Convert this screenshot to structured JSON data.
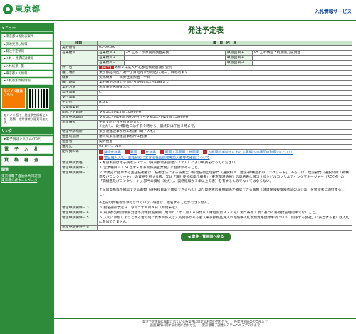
{
  "header": {
    "logo_text": "東京都",
    "service_label": "入札情報サービス"
  },
  "sidebar": {
    "menu_heading": "メニュー",
    "menu_items": [
      "▶東京都公報発表案件",
      "▶調達見通し情報",
      "▶発注予定情報",
      "▶入札・見積経過情報",
      "▶入札結果一覧",
      "▶東京都入札情報",
      "▶入札参加資格情報"
    ],
    "mobile_button": "モバイル版はこちら",
    "mobile_note": "モバイル版は、発注予定情報と入札（見積）結果情報が閲覧可能です。",
    "links_heading": "リンク",
    "system_item": "▶電子調達システム(TOP)",
    "big_items": [
      "電　子　入　札",
      "資　格　審　査"
    ],
    "related_heading": "関連",
    "related_links": [
      "東京都電子自治体共同運営",
      "東京都公式ホームページ"
    ]
  },
  "page_title": "発注予定表",
  "table_header": {
    "item": "項目",
    "content": "項　目　内　容"
  },
  "contract_no": {
    "label": "契約番号",
    "value": "05-00186"
  },
  "business_types": {
    "label": "営業種目",
    "types": [
      {
        "k": "営業種目１",
        "v": "24 土木・水系関係調査業務"
      },
      {
        "k": "営業種目２",
        "v": ""
      },
      {
        "k": "営業種目３",
        "v": ""
      }
    ],
    "handles": [
      {
        "k": "取扱品目１",
        "v": "04 土木構造・耐震耐力度調査"
      },
      {
        "k": "取扱品目２",
        "v": ""
      },
      {
        "k": "取扱品目３",
        "v": ""
      }
    ]
  },
  "rows": [
    {
      "k": "件　名",
      "v": "令和５年度大井北部陸橋耐震設計委託",
      "badge": "【電子】"
    },
    {
      "k": "履行場所",
      "v": "東京都品川区八潮一丁目地内から同区八潮二丁目地内まで"
    },
    {
      "k": "概要",
      "v": "委託概要　　橋梁性能照査　一式"
    },
    {
      "k": "履行期間",
      "v": "契約確定の日の翌日から令和6年2月29日まで"
    },
    {
      "k": "契約方法",
      "v": "希望制指名競争入札"
    },
    {
      "k": "発注等級",
      "v": "C"
    },
    {
      "k": "受付等級",
      "v": ""
    },
    {
      "k": "その他",
      "v": "A,B,C"
    },
    {
      "k": "公開事業日",
      "v": ""
    },
    {
      "k": "開札予定日時",
      "v": "令和5年8月23日 10時00分"
    },
    {
      "k": "希望申請期間",
      "v": "令和5年7月24日 9時00分から令和5年7月28日 15時00分"
    },
    {
      "k": "希望備考",
      "v": "午前８時から午後９時まで。\n※ただし、公共開始日は午前９時から、最終日は午後３時まで。"
    },
    {
      "k": "希望申請場所",
      "v": "東京港建設事務所工務課（電子入札）"
    },
    {
      "k": "担当局部課",
      "v": "港湾局東京港建設事務所工務課"
    },
    {
      "k": "担当者",
      "v": "契約担当"
    },
    {
      "k": "連絡先",
      "v": "03-3471-0107"
    }
  ],
  "files": {
    "label": "配布資料等",
    "items": [
      "特記仕様書",
      "図面",
      "仕様書",
      "図面・平面図・断面図",
      "入札契約手続きにおける書類への押印の取扱いについて",
      "物品購入入札・委託契約における社会保険等加入者等の確認について"
    ]
  },
  "conditions": [
    {
      "k": "希望申請資格",
      "v": "・希望申請は電子調達システム（東京都電子調達システム）により申請を行ってください。"
    },
    {
      "k": "希望申請要件－１",
      "v": "１.営業種目１「24 土木・水系関係調査業務」に登録があること。"
    },
    {
      "k": "希望申請要件－２",
      "v": "２.本委託に従事する主任技術者は、技術士法による技術士（総合技術監理部門（選択科目「建設-鋼構造及びコンクリート」）あるいは、建設部門（選択科目「鋼構造及びコンクリート」）の資格を有する者、又は「設計要領標準仕様書」（東京都港湾局）の資格表に該当するシビルコンサルティングマネージャー（RCCM）の「鋼構造及びコンクリート」部門の資格（ただし、実務経験が３年以上の者）を有するものでなくてはならない。\n\n上記の資格等が確認できる書類（選択科目まで確認できるもの）及び資格者の雇用関係が確認できる書類（健康保険被保険者証の写し等）を希望者に添付すること。\n\n※上記の資格等が添付されていない場合は、指名することができません。"
    },
    {
      "k": "希望申請要件－３",
      "v": "３.指名通知予定日　令和５年８月８日（時間未定）"
    },
    {
      "k": "希望申請要件－４",
      "v": "４.東京都契約関係暴力団等対策措置要綱（昭和６２年１月１４日付６１財経庶第９２２号）第５条第１項に基づく排除措置期間中でないこと。"
    },
    {
      "k": "希望申請要件－５",
      "v": "５.入札に参加しようとする者の間に資本関係又は人的関係がある者（東京都物品買入れ等競争入札参加資格登録事項にいう「関係する会社」に該当する者）は入札に参加できません。"
    },
    {
      "k": "希望申請要件－６",
      "v": ""
    }
  ],
  "back_button": "◀ 案件一覧画面へ戻る",
  "footer": {
    "line1": "発注予定情報に掲載されている各案件に関するお問い合わせ先　　各発注部局の担当部まで",
    "line2": "画面操作に関するお問い合わせ先　　東京都電子調達システムヘルプデスクまで"
  }
}
